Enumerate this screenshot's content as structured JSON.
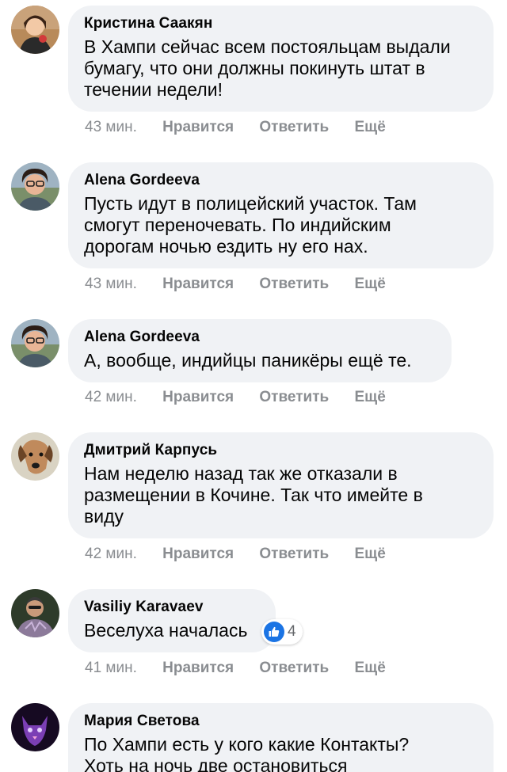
{
  "actions": {
    "like": "Нравится",
    "reply": "Ответить",
    "more": "Ещё"
  },
  "comments": [
    {
      "author": "Кристина Саакян",
      "text": "В Хампи сейчас всем постояльцам выдали\nбумагу, что они должны покинуть штат в\nтечении недели!",
      "time": "43 мин."
    },
    {
      "author": "Alena Gordeeva",
      "text": "Пусть идут в полицейский участок. Там\nсмогут переночевать. По индийским\nдорогам ночью ездить ну его нах.",
      "time": "43 мин."
    },
    {
      "author": "Alena Gordeeva",
      "text": "А, вообще, индийцы паникёры ещё те.",
      "time": "42 мин."
    },
    {
      "author": "Дмитрий Карпусь",
      "text": "Нам неделю назад так же отказали в\nразмещении в Кочине. Так что имейте в\nвиду",
      "time": "42 мин."
    },
    {
      "author": "Vasiliy Karavaev",
      "text": "Веселуха началась",
      "time": "41 мин.",
      "reaction": {
        "icon": "like-icon",
        "count": "4"
      }
    },
    {
      "author": "Мария Светова",
      "text": "По Хампи есть у кого какие Контакты?\nХоть на ночь две остановиться",
      "time": ""
    }
  ],
  "colors": {
    "bubble": "#f0f2f5",
    "meta_text": "#8a8d91",
    "like_blue": "#1b74e4"
  }
}
